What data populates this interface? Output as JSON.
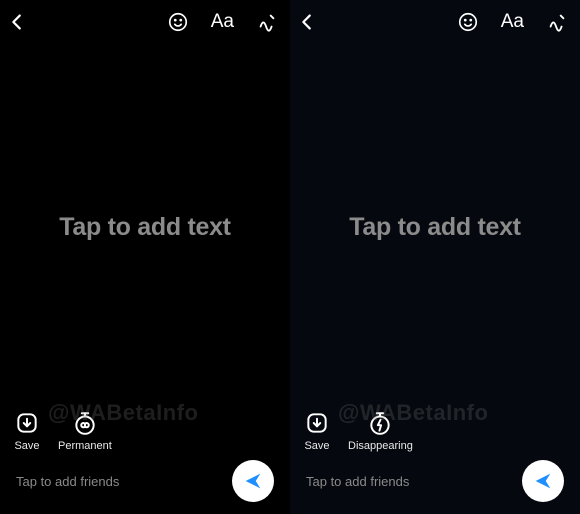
{
  "panes": [
    {
      "placeholder": "Tap to add text",
      "actions": {
        "save": "Save",
        "mode": "Permanent"
      },
      "footer": "Tap to add friends",
      "watermark": "@WABetaInfo"
    },
    {
      "placeholder": "Tap to add text",
      "actions": {
        "save": "Save",
        "mode": "Disappearing"
      },
      "footer": "Tap to add friends",
      "watermark": "@WABetaInfo"
    }
  ]
}
